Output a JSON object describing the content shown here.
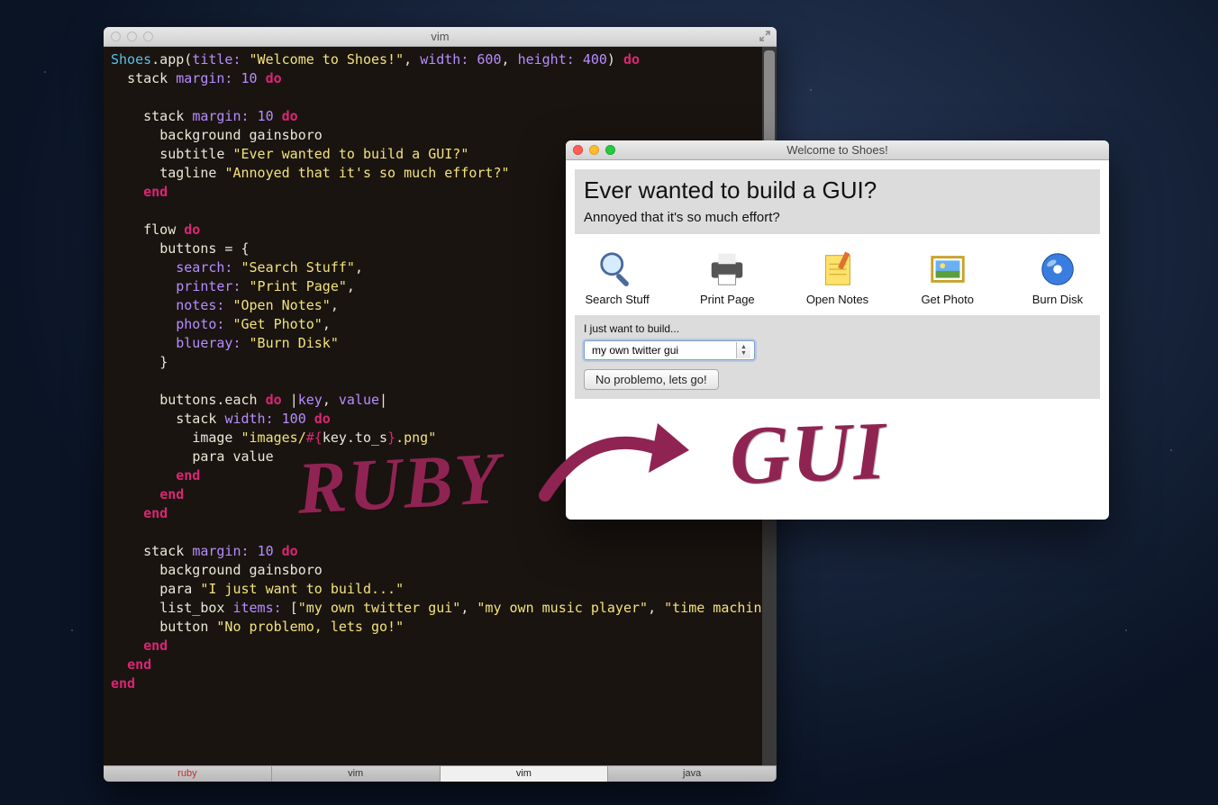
{
  "vim": {
    "title": "vim",
    "tabs": [
      "ruby",
      "vim",
      "vim",
      "java"
    ],
    "active_tab_index": 2,
    "code": {
      "l1_class": "Shoes",
      "l1_method": ".app(",
      "l1_k1": "title:",
      "l1_v1": "\"Welcome to Shoes!\"",
      "l1_k2": "width:",
      "l1_v2": "600",
      "l1_k3": "height:",
      "l1_v3": "400",
      "l1_close": ")",
      "do": "do",
      "end": "end",
      "l2_stack": "stack",
      "l2_margin": "margin:",
      "l2_margin_v": "10",
      "l4_bg": "background gainsboro",
      "l5_sub": "subtitle",
      "l5_str": "\"Ever wanted to build a GUI?\"",
      "l6_tag": "tagline",
      "l6_str": "\"Annoyed that it's so much effort?\"",
      "l9_flow": "flow",
      "l10_buttons_eq": "buttons = {",
      "l11_k": "search:",
      "l11_v": "\"Search Stuff\"",
      "l12_k": "printer:",
      "l12_v": "\"Print Page\"",
      "l13_k": "notes:",
      "l13_v": "\"Open Notes\"",
      "l14_k": "photo:",
      "l14_v": "\"Get Photo\"",
      "l15_k": "blueray:",
      "l15_v": "\"Burn Disk\"",
      "l16_close": "}",
      "l18_each": "buttons.each",
      "l18_pipe": "|",
      "l18_key": "key",
      "l18_value": "value",
      "l19_width": "width:",
      "l19_width_v": "100",
      "l20_image": "image",
      "l20_str_a": "\"images/",
      "l20_interp": "#{",
      "l20_interp_body": "key.to_s",
      "l20_interp_close": "}",
      "l20_str_b": ".png\"",
      "l21_para": "para value",
      "l26_para": "para",
      "l26_str": "\"I just want to build...\"",
      "l27_listbox": "list_box",
      "l27_items": "items:",
      "l27_a": "\"my own twitter gui\"",
      "l27_b": "\"my own music player\"",
      "l27_c": "\"time machine\"",
      "l28_button": "button",
      "l28_str": "\"No problemo, lets go!\""
    }
  },
  "gui": {
    "title": "Welcome to Shoes!",
    "subtitle": "Ever wanted to build a GUI?",
    "tagline": "Annoyed that it's so much effort?",
    "icons": [
      {
        "label": "Search Stuff",
        "name": "search"
      },
      {
        "label": "Print Page",
        "name": "printer"
      },
      {
        "label": "Open Notes",
        "name": "notes"
      },
      {
        "label": "Get Photo",
        "name": "photo"
      },
      {
        "label": "Burn Disk",
        "name": "blueray"
      }
    ],
    "build_label": "I just want to build...",
    "combo_value": "my own twitter gui",
    "go_button": "No problemo, lets go!"
  },
  "hand": {
    "ruby": "Ruby",
    "gui": "GUI"
  }
}
